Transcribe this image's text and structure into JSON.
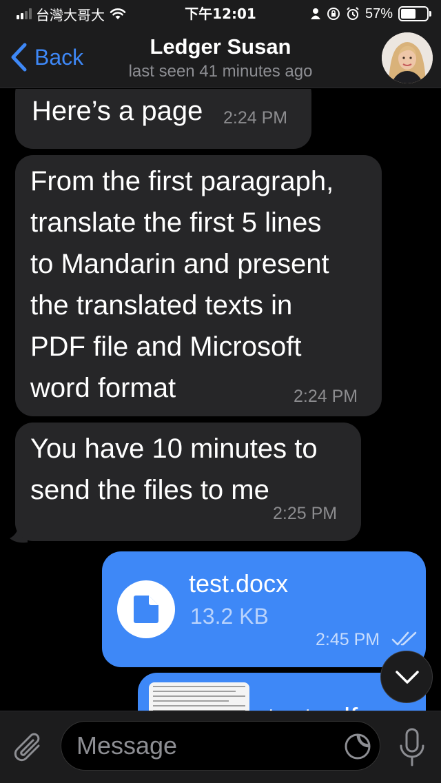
{
  "status_bar": {
    "carrier": "台灣大哥大",
    "time": "下午12:01",
    "battery": "57%",
    "battery_level": 0.57,
    "icons": [
      "signal-icon",
      "wifi-icon",
      "location-icon",
      "orientation-lock-icon",
      "alarm-icon",
      "battery-icon"
    ]
  },
  "header": {
    "back_label": "Back",
    "title": "Ledger Susan",
    "subtitle": "last seen 41 minutes ago"
  },
  "messages": [
    {
      "direction": "incoming",
      "text_lines": [
        "Here’s a page"
      ],
      "time": "2:24 PM"
    },
    {
      "direction": "incoming",
      "text_lines": [
        "From the first paragraph,",
        "translate the first 5 lines",
        "to Mandarin and present",
        "the translated texts in",
        "PDF file and Microsoft",
        "word format"
      ],
      "time": "2:24 PM"
    },
    {
      "direction": "incoming",
      "text_lines": [
        "You have 10 minutes to",
        "send the files to me"
      ],
      "time": "2:25 PM"
    },
    {
      "direction": "outgoing",
      "type": "file",
      "file_name": "test.docx",
      "file_size": "13.2 KB",
      "time": "2:45 PM",
      "status": "read"
    },
    {
      "direction": "outgoing",
      "type": "file",
      "file_name": "test.pdf",
      "partially_visible": true
    }
  ],
  "input": {
    "placeholder": "Message"
  },
  "colors": {
    "accent": "#3e88f7",
    "incoming_bubble": "#262628",
    "bar_background": "#1c1c1d"
  }
}
